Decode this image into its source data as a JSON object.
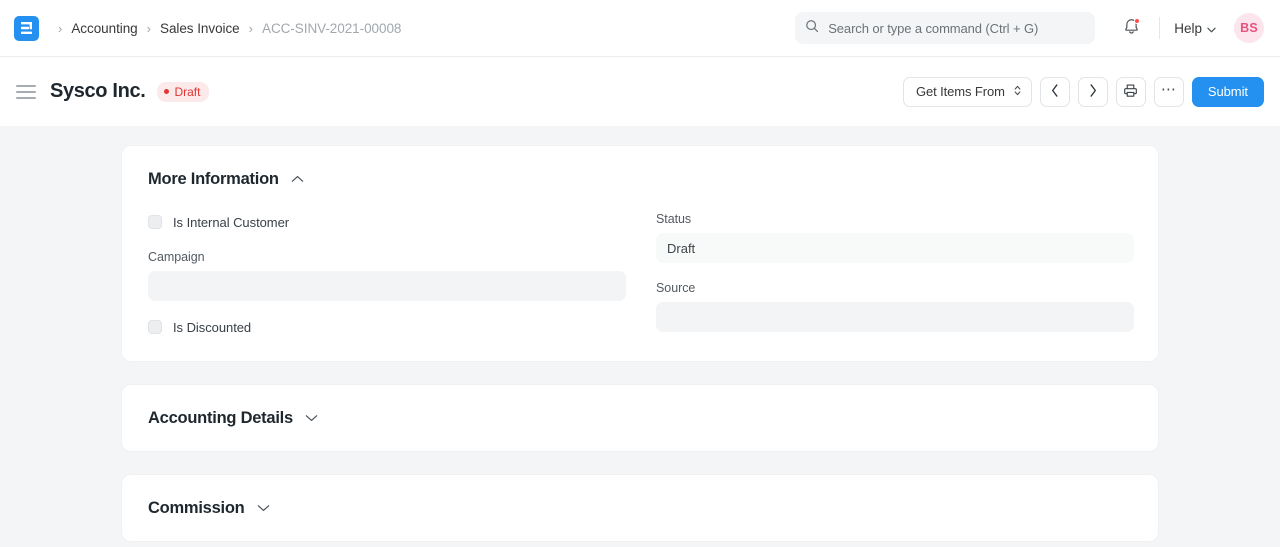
{
  "navbar": {
    "logo_icon": "frappe-logo-icon",
    "breadcrumb": [
      {
        "label": "Accounting",
        "current": false
      },
      {
        "label": "Sales Invoice",
        "current": false
      },
      {
        "label": "ACC-SINV-2021-00008",
        "current": true
      }
    ],
    "separator": "›",
    "search": {
      "placeholder": "Search or type a command (Ctrl + G)",
      "value": "",
      "icon": "search-icon"
    },
    "notifications": {
      "icon": "bell-icon",
      "has_unread": true
    },
    "help": {
      "label": "Help",
      "icon": "chevron-down-icon"
    },
    "avatar": {
      "initials": "BS"
    }
  },
  "titlebar": {
    "menu_icon": "hamburger-icon",
    "title": "Sysco Inc.",
    "status": {
      "label": "Draft",
      "color": "#E03636",
      "background": "#FCE9E9"
    },
    "actions": {
      "get_items_from": {
        "label": "Get Items From",
        "icon": "chevron-updown-icon"
      },
      "prev": {
        "icon": "chevron-left-icon"
      },
      "next": {
        "icon": "chevron-right-icon"
      },
      "print": {
        "icon": "printer-icon"
      },
      "more": {
        "icon": "ellipsis-icon"
      },
      "submit": {
        "label": "Submit",
        "color": "#2490EF"
      }
    }
  },
  "sections": [
    {
      "title": "More Information",
      "expanded": true,
      "toggle_icon": "chevron-up-icon",
      "fields": {
        "is_internal_customer": {
          "label": "Is Internal Customer",
          "checked": false
        },
        "campaign": {
          "label": "Campaign",
          "value": "",
          "readonly": false
        },
        "is_discounted": {
          "label": "Is Discounted",
          "checked": false
        },
        "status": {
          "label": "Status",
          "value": "Draft",
          "readonly": true
        },
        "source": {
          "label": "Source",
          "value": "",
          "readonly": false
        }
      }
    },
    {
      "title": "Accounting Details",
      "expanded": false,
      "toggle_icon": "chevron-down-icon"
    },
    {
      "title": "Commission",
      "expanded": false,
      "toggle_icon": "chevron-down-icon"
    }
  ]
}
